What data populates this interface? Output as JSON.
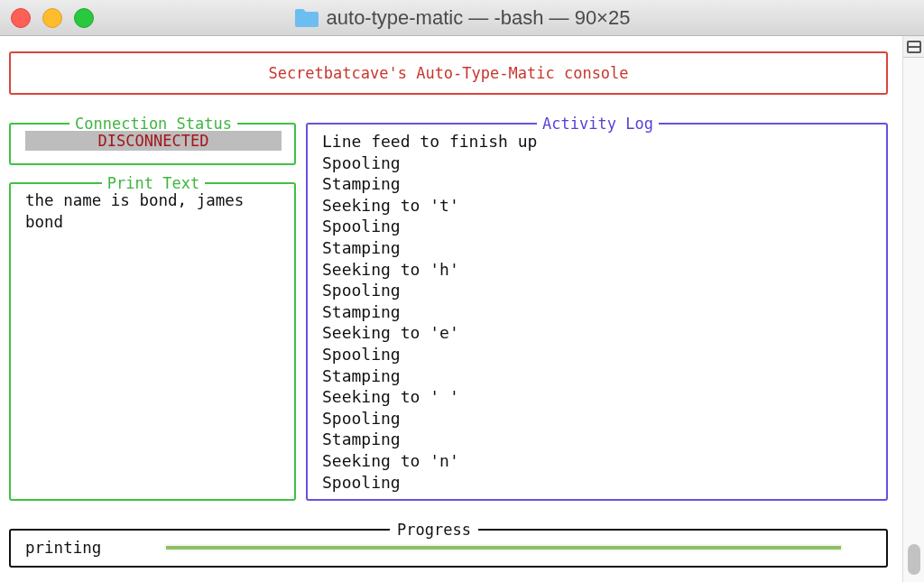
{
  "window": {
    "title": "auto-type-matic — -bash — 90×25"
  },
  "header": {
    "title": "Secretbatcave's Auto-Type-Matic console"
  },
  "connection_status": {
    "title": "Connection Status",
    "status": "DISCONNECTED"
  },
  "print_text": {
    "title": "Print Text",
    "text": "the name is bond, james bond"
  },
  "activity_log": {
    "title": "Activity Log",
    "lines": [
      "Line feed to finish up",
      "Spooling",
      "Stamping",
      "Seeking to 't'",
      "Spooling",
      "Stamping",
      "Seeking to 'h'",
      "Spooling",
      "Stamping",
      "Seeking to 'e'",
      "Spooling",
      "Stamping",
      "Seeking to ' '",
      "Spooling",
      "Stamping",
      "Seeking to 'n'",
      "Spooling"
    ]
  },
  "progress": {
    "title": "Progress",
    "label": "printing",
    "level": 1
  }
}
